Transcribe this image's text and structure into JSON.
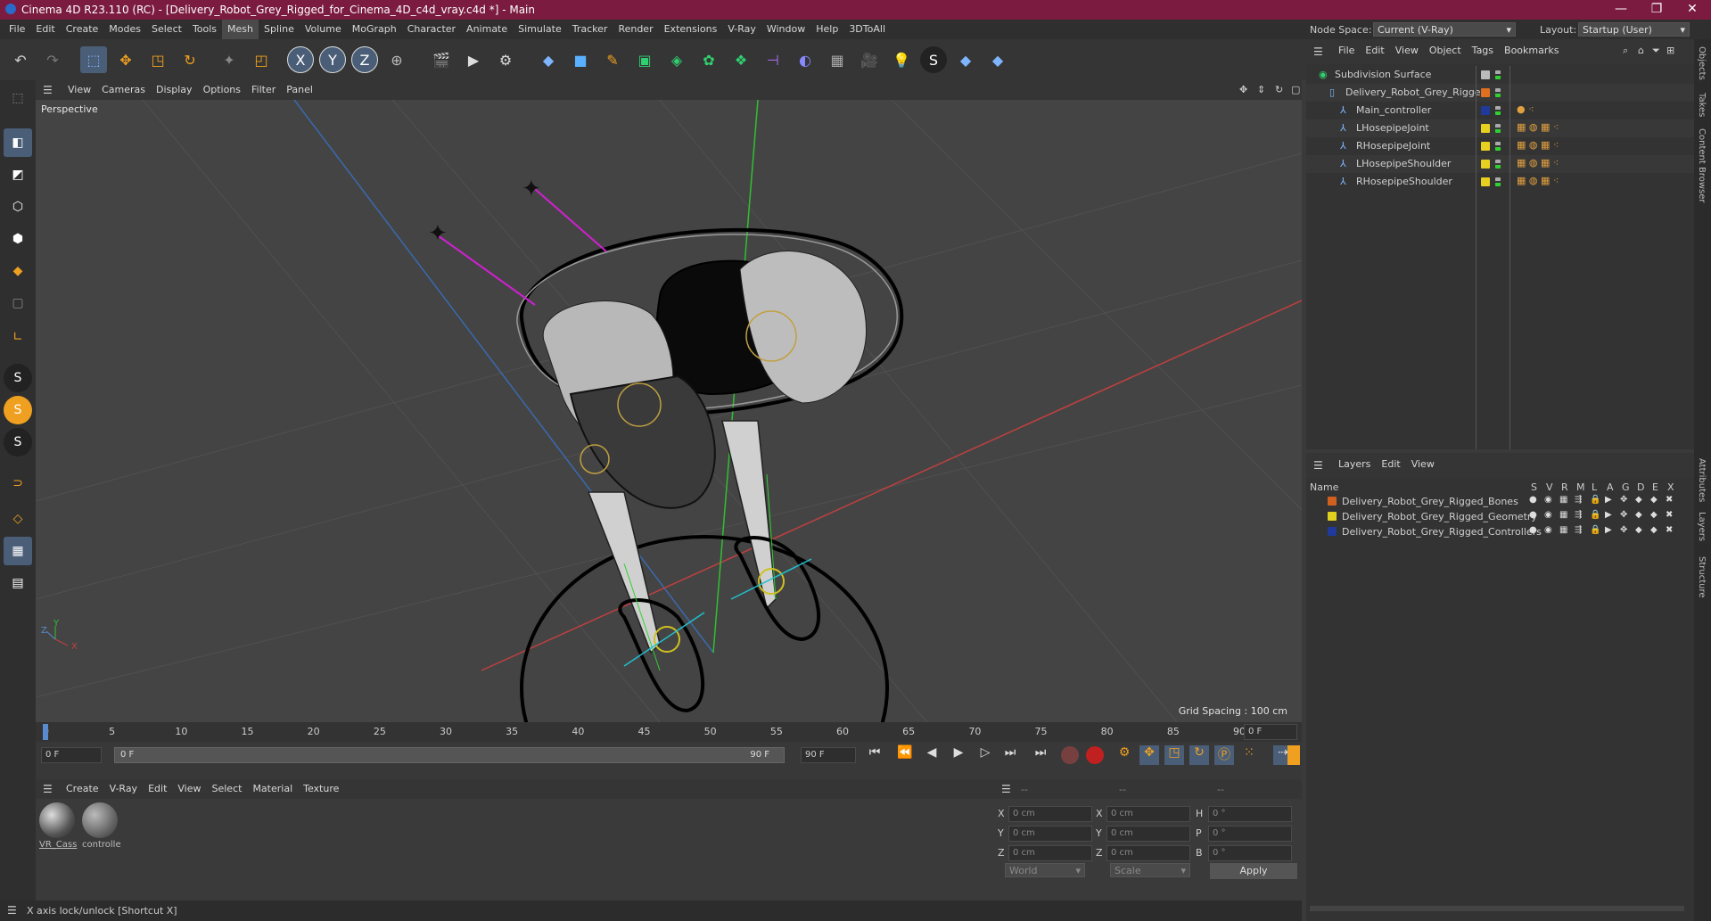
{
  "window": {
    "title": "Cinema 4D R23.110 (RC) - [Delivery_Robot_Grey_Rigged_for_Cinema_4D_c4d_vray.c4d *] - Main",
    "minimize": "—",
    "maximize": "❐",
    "close": "✕"
  },
  "menu": [
    "File",
    "Edit",
    "Create",
    "Modes",
    "Select",
    "Tools",
    "Mesh",
    "Spline",
    "Volume",
    "MoGraph",
    "Character",
    "Animate",
    "Simulate",
    "Tracker",
    "Render",
    "Extensions",
    "V-Ray",
    "Window",
    "Help",
    "3DToAll"
  ],
  "menu_active": "Mesh",
  "nodespace": {
    "label": "Node Space:",
    "value": "Current (V-Ray)"
  },
  "layout": {
    "label": "Layout:",
    "value": "Startup (User)"
  },
  "viewport": {
    "menu": [
      "View",
      "Cameras",
      "Display",
      "Options",
      "Filter",
      "Panel"
    ],
    "label": "Perspective",
    "grid_spacing": "Grid Spacing : 100 cm",
    "axis_x": "X",
    "axis_y": "Y",
    "axis_z": "Z"
  },
  "timeline": {
    "ticks": [
      "0",
      "5",
      "10",
      "15",
      "20",
      "25",
      "30",
      "35",
      "40",
      "45",
      "50",
      "55",
      "60",
      "65",
      "70",
      "75",
      "80",
      "85",
      "90"
    ],
    "current_frame": "0 F",
    "start_field": "0 F",
    "range_start": "0 F",
    "range_end": "90 F",
    "end_field": "90 F"
  },
  "material_manager": {
    "menu": [
      "Create",
      "V-Ray",
      "Edit",
      "View",
      "Select",
      "Material",
      "Texture"
    ],
    "materials": [
      "VR_Cass",
      "controlle"
    ]
  },
  "coordinates": {
    "header": [
      "--",
      "--",
      "--"
    ],
    "rows": [
      {
        "a": "X",
        "av": "0 cm",
        "b": "X",
        "bv": "0 cm",
        "c": "H",
        "cv": "0 °"
      },
      {
        "a": "Y",
        "av": "0 cm",
        "b": "Y",
        "bv": "0 cm",
        "c": "P",
        "cv": "0 °"
      },
      {
        "a": "Z",
        "av": "0 cm",
        "b": "Z",
        "bv": "0 cm",
        "c": "B",
        "cv": "0 °"
      }
    ],
    "mode": "World",
    "scale": "Scale",
    "apply": "Apply"
  },
  "status": "X axis lock/unlock [Shortcut X]",
  "object_manager": {
    "menu": [
      "File",
      "Edit",
      "View",
      "Object",
      "Tags",
      "Bookmarks"
    ],
    "objects": [
      {
        "name": "Subdivision Surface",
        "color": "#bbbbbb"
      },
      {
        "name": "Delivery_Robot_Grey_Rigged",
        "color": "#e07020"
      },
      {
        "name": "Main_controller",
        "color": "#1f3a9a"
      },
      {
        "name": "LHosepipeJoint",
        "color": "#e8d020"
      },
      {
        "name": "RHosepipeJoint",
        "color": "#e8d020"
      },
      {
        "name": "LHosepipeShoulder",
        "color": "#e8d020"
      },
      {
        "name": "RHosepipeShoulder",
        "color": "#e8d020"
      }
    ]
  },
  "layer_manager": {
    "menu": [
      "Layers",
      "Edit",
      "View"
    ],
    "header_name": "Name",
    "columns": [
      "S",
      "V",
      "R",
      "M",
      "L",
      "A",
      "G",
      "D",
      "E",
      "X"
    ],
    "layers": [
      {
        "name": "Delivery_Robot_Grey_Rigged_Bones",
        "color": "#d06020"
      },
      {
        "name": "Delivery_Robot_Grey_Rigged_Geometry",
        "color": "#e0d020"
      },
      {
        "name": "Delivery_Robot_Grey_Rigged_Controllers",
        "color": "#1f3a9a"
      }
    ]
  },
  "side_tabs": [
    "Objects",
    "Takes",
    "Content Browser",
    "Attributes",
    "Layers",
    "Structure"
  ]
}
